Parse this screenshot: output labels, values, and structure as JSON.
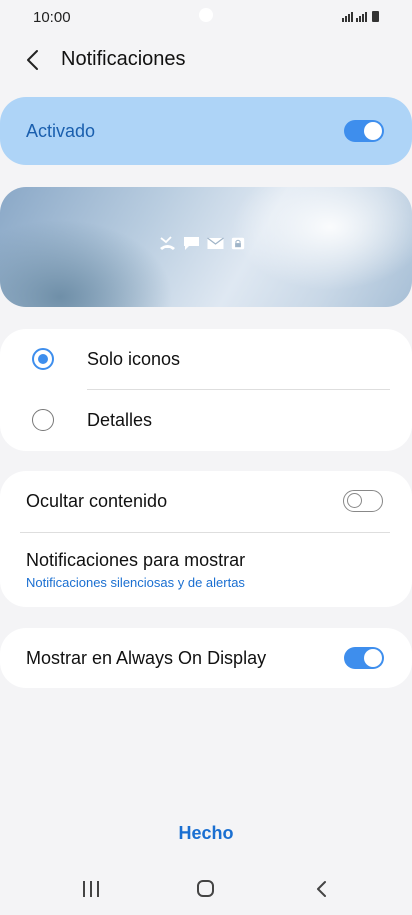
{
  "status_bar": {
    "time": "10:00"
  },
  "header": {
    "title": "Notificaciones"
  },
  "master_toggle": {
    "label": "Activado",
    "state": "on"
  },
  "preview": {
    "icons": [
      "missed-call-icon",
      "message-icon",
      "email-icon",
      "lock-icon"
    ]
  },
  "style_options": {
    "items": [
      {
        "label": "Solo iconos",
        "selected": true
      },
      {
        "label": "Detalles",
        "selected": false
      }
    ]
  },
  "settings": {
    "hide_content": {
      "label": "Ocultar contenido",
      "state": "off"
    },
    "notifications_to_show": {
      "label": "Notificaciones para mostrar",
      "value": "Notificaciones silenciosas y de alertas"
    }
  },
  "aod": {
    "label": "Mostrar en Always On Display",
    "state": "on"
  },
  "footer": {
    "done_label": "Hecho"
  },
  "colors": {
    "accent": "#3e8eed",
    "link": "#1a6fd1",
    "master_bg": "#aed4f7"
  }
}
